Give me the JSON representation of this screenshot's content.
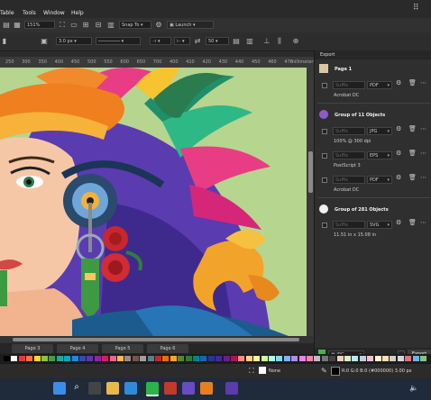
{
  "menu": {
    "items": [
      "Table",
      "Tools",
      "Window",
      "Help"
    ]
  },
  "toolbar": {
    "zoom": "151%",
    "snap_to": "Snap To",
    "launch": "Launch",
    "outline_width": "3.0 px",
    "value_50": "50"
  },
  "ruler": {
    "ticks": [
      "250",
      "300",
      "350",
      "400",
      "450",
      "500",
      "550",
      "600",
      "650",
      "700",
      "400",
      "410",
      "420",
      "430",
      "440",
      "450",
      "460",
      "470"
    ],
    "unit": "millimeters"
  },
  "pages": [
    "Page 3",
    "Page 4",
    "Page 5",
    "Page 6"
  ],
  "panel": {
    "title": "Export",
    "groups": [
      {
        "title": "Page 1",
        "rows": [
          {
            "suffix": "Suffix",
            "format": "PDF",
            "caption": "Acrobat DC"
          }
        ]
      },
      {
        "title": "Group of 11 Objects",
        "rows": [
          {
            "suffix": "Suffix",
            "format": "JPG",
            "caption": "100% @ 300 dpi"
          },
          {
            "suffix": "Suffix",
            "format": "EPS",
            "caption": "PostScript 3"
          },
          {
            "suffix": "Suffix",
            "format": "PDF",
            "caption": "Acrobat DC"
          }
        ]
      },
      {
        "title": "Group of 281 Objects",
        "rows": [
          {
            "suffix": "Suffix",
            "format": "SVG",
            "caption": "11.51 in x 15.08 in"
          }
        ]
      }
    ],
    "export_format": "JPG",
    "export_button": "Export"
  },
  "status": {
    "fill": "None",
    "outline": "R:0 G:0 B:0 (#000000)  3.00 px"
  },
  "colors": {
    "canvas_bg": "#b6d58f",
    "palette": [
      "#000000",
      "#ffffff",
      "#e53935",
      "#ff7043",
      "#fdd835",
      "#8bc34a",
      "#43a047",
      "#26a69a",
      "#00acc1",
      "#1e88e5",
      "#3949ab",
      "#5e35b1",
      "#8e24aa",
      "#d81b60",
      "#f06292",
      "#ffb74d",
      "#a1887f",
      "#795548",
      "#9e9e9e",
      "#607d8b",
      "#c62828",
      "#ef6c00",
      "#f9a825",
      "#558b2f",
      "#2e7d32",
      "#00838f",
      "#1565c0",
      "#283593",
      "#4527a0",
      "#6a1b9a",
      "#ad1457",
      "#ff8a80",
      "#ffd180",
      "#ffff8d",
      "#ccff90",
      "#a7ffeb",
      "#80d8ff",
      "#82b1ff",
      "#b388ff",
      "#ea80fc",
      "#ff80ab",
      "#bdbdbd",
      "#757575",
      "#424242",
      "#ffccbc",
      "#dcedc8",
      "#b2ebf2",
      "#c5cae9",
      "#f8bbd0",
      "#fff9c4",
      "#ffe0b2",
      "#d7ccc8",
      "#cfd8dc",
      "#e57373",
      "#64b5f6",
      "#81c784"
    ]
  }
}
